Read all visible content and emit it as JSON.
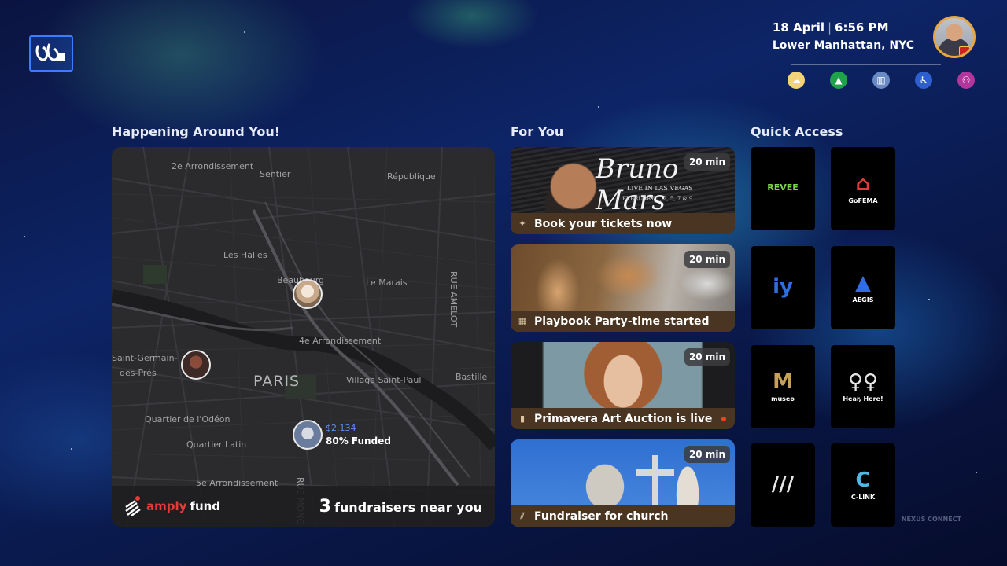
{
  "header": {
    "date": "18 April",
    "time": "6:56 PM",
    "location": "Lower Manhattan, NYC",
    "status_icons": [
      {
        "name": "weather-icon",
        "bg": "#f3d27a",
        "glyph": "☁"
      },
      {
        "name": "hiking-icon",
        "bg": "#1fa34a",
        "glyph": "▲"
      },
      {
        "name": "trash-icon",
        "bg": "#6a8ac6",
        "glyph": "▥"
      },
      {
        "name": "accessibility-icon",
        "bg": "#2f5fcf",
        "glyph": "♿"
      },
      {
        "name": "community-icon",
        "bg": "#b2379c",
        "glyph": "⚇"
      }
    ]
  },
  "sections": {
    "happening": "Happening Around You!",
    "for_you": "For You",
    "quick_access": "Quick Access"
  },
  "map": {
    "labels": {
      "l1": "2e Arrondissement",
      "l2": "Sentier",
      "l3": "République",
      "l4": "Les Halles",
      "l5": "Beaubourg",
      "l6": "Le Marais",
      "l7": "RUE AMELOT",
      "l8": "4e Arrondissement",
      "l9": "Saint-Germain-",
      "l10": "des-Prés",
      "l11": "PARIS",
      "l12": "Village Saint-Paul",
      "l13": "Bastille",
      "l14": "Quartier de l'Odéon",
      "l15": "Quartier Latin",
      "l16": "5e Arrondissement",
      "l17": "RUE MONG"
    },
    "fund_amount": "$2,134",
    "fund_pct": "80% Funded",
    "brand_prefix": "amply",
    "brand_suffix": "fund",
    "near_count": "3",
    "near_text": "fundraisers near you"
  },
  "for_you": [
    {
      "title": "Book your tickets now",
      "badge": "20 min",
      "poster_title": "Bruno Mars",
      "poster_sub": "LIVE IN LAS VEGAS",
      "poster_dates": "FEBRUARY 1, 2, 5, 7 & 9"
    },
    {
      "title": "Playbook Party-time started",
      "badge": "20 min"
    },
    {
      "title": "Primavera Art Auction is live",
      "badge": "20 min"
    },
    {
      "title": "Fundraiser for church",
      "badge": "20 min"
    }
  ],
  "quick_access": [
    {
      "name": "revee",
      "icon_text": "REVEE",
      "label": "",
      "color": "#7fd24a"
    },
    {
      "name": "gofema",
      "icon_text": "⌂",
      "label": "GoFEMA",
      "color": "#e03a3a"
    },
    {
      "name": "iy",
      "icon_text": "iy",
      "label": "",
      "color": "#2e6de6"
    },
    {
      "name": "aegis",
      "icon_text": "▲",
      "label": "AEGIS",
      "color": "#2e6de6"
    },
    {
      "name": "museo",
      "icon_text": "M",
      "label": "museo",
      "color": "#c6a15b"
    },
    {
      "name": "hear-here",
      "icon_text": "♀♀",
      "label": "Hear, Here!",
      "color": "#e6e6e6"
    },
    {
      "name": "amplyfund",
      "icon_text": "///",
      "label": "",
      "color": "#e6e6e6"
    },
    {
      "name": "c-link",
      "icon_text": "C",
      "label": "C-LINK",
      "color": "#4fb7e6"
    }
  ],
  "footer_mark": "NEXUS CONNECT"
}
